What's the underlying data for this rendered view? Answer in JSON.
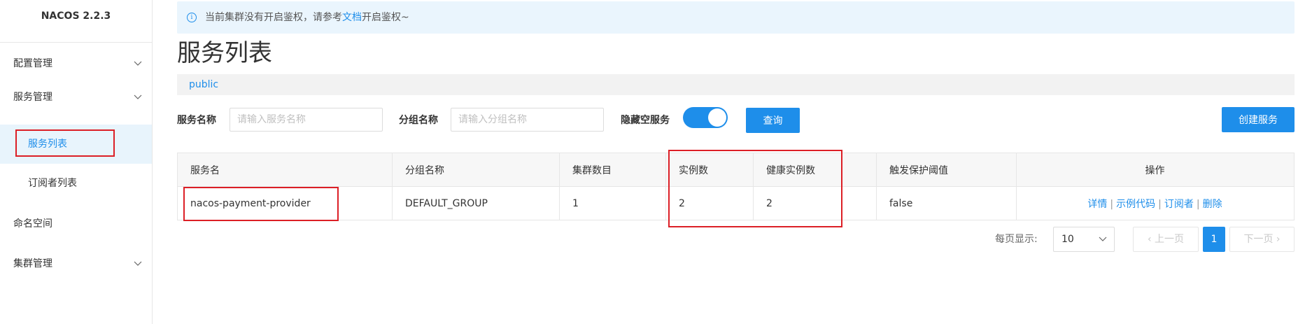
{
  "app": {
    "title": "NACOS 2.2.3"
  },
  "sidebar": {
    "items": [
      {
        "label": "配置管理",
        "expandable": true
      },
      {
        "label": "服务管理",
        "expandable": true,
        "children": [
          {
            "label": "服务列表",
            "active": true
          },
          {
            "label": "订阅者列表",
            "active": false
          }
        ]
      },
      {
        "label": "命名空间",
        "expandable": false
      },
      {
        "label": "集群管理",
        "expandable": true
      }
    ]
  },
  "notice": {
    "text_before": "当前集群没有开启鉴权，请参考",
    "link": "文档",
    "text_after": "开启鉴权~"
  },
  "page": {
    "title": "服务列表",
    "namespace": "public"
  },
  "filters": {
    "service_name_label": "服务名称",
    "service_name_placeholder": "请输入服务名称",
    "group_name_label": "分组名称",
    "group_name_placeholder": "请输入分组名称",
    "hide_empty_label": "隐藏空服务",
    "hide_empty_on": true,
    "query_button": "查询",
    "create_button": "创建服务"
  },
  "table": {
    "columns": [
      "服务名",
      "分组名称",
      "集群数目",
      "实例数",
      "健康实例数",
      "触发保护阈值",
      "操作"
    ],
    "rows": [
      {
        "service": "nacos-payment-provider",
        "group": "DEFAULT_GROUP",
        "clusters": "1",
        "instances": "2",
        "healthy": "2",
        "threshold": "false",
        "actions": [
          "详情",
          "示例代码",
          "订阅者",
          "删除"
        ]
      }
    ]
  },
  "pagination": {
    "page_size_label": "每页显示:",
    "page_size": "10",
    "prev": "上一页",
    "next": "下一页",
    "current": "1"
  },
  "colors": {
    "accent": "#1e8eea",
    "annotation": "#dc1f26",
    "active_bg": "#e8f4fc"
  }
}
